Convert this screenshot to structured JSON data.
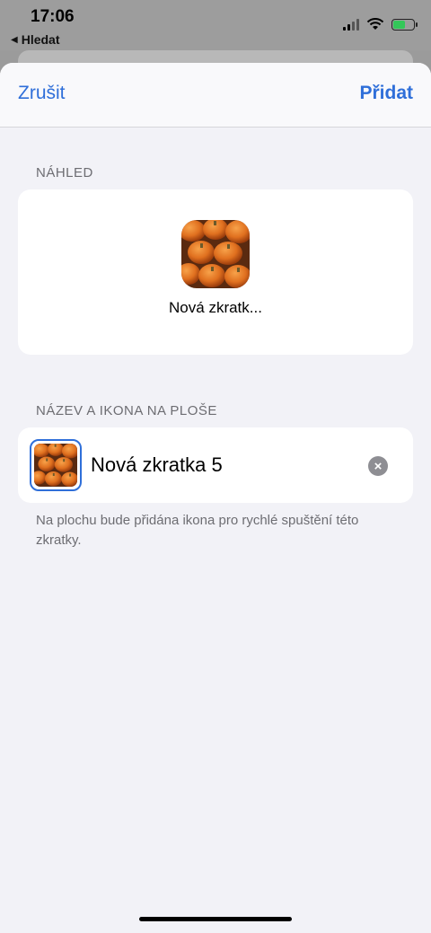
{
  "status_bar": {
    "time": "17:06",
    "back_label": "Hledat"
  },
  "nav": {
    "cancel_label": "Zrušit",
    "add_label": "Přidat"
  },
  "preview": {
    "header": "NÁHLED",
    "label": "Nová zkratk..."
  },
  "name_section": {
    "header": "NÁZEV A IKONA NA PLOŠE",
    "name_value": "Nová zkratka 5"
  },
  "footer_note": "Na plochu bude přidána ikona pro rychlé spuštění této zkratky.",
  "icons": {
    "shortcut_icon": "pumpkins-photo-icon",
    "clear": "clear-text-icon"
  },
  "colors": {
    "accent": "#2f6fd9",
    "background": "#f2f2f7"
  }
}
